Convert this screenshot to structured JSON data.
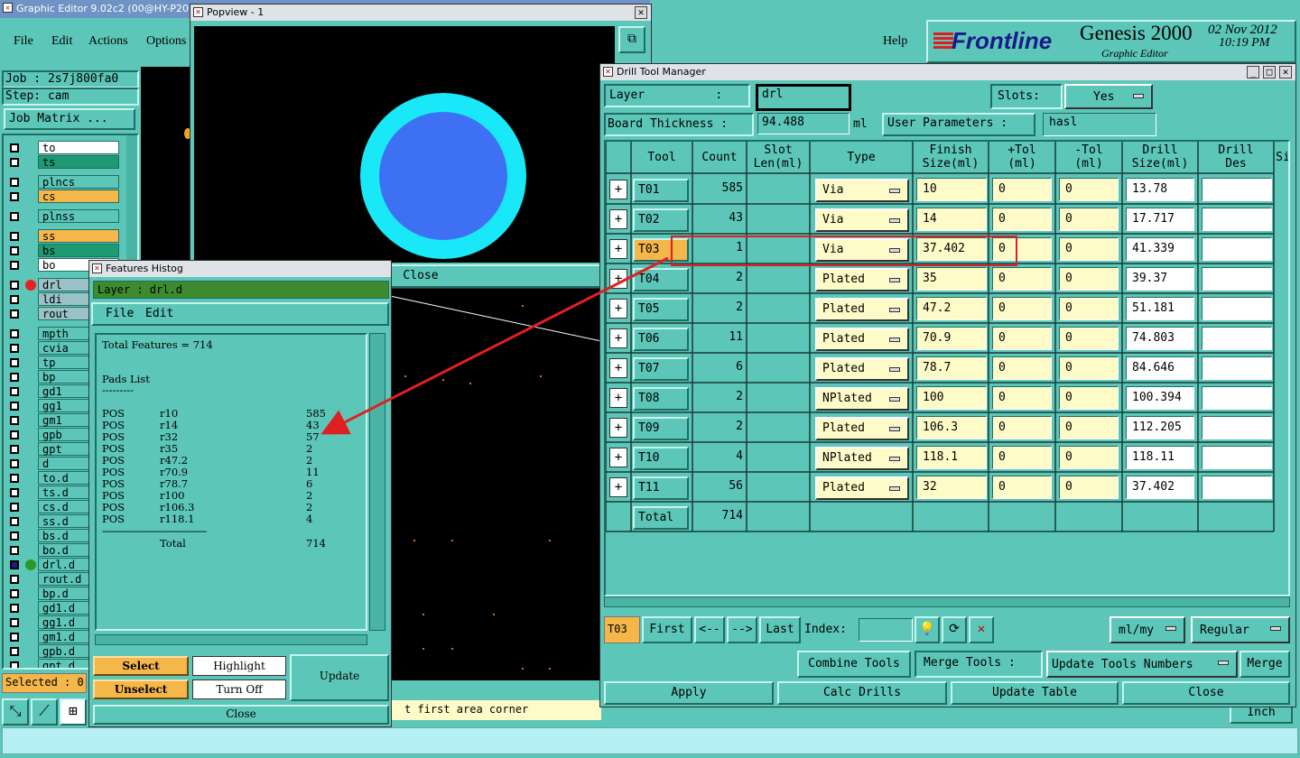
{
  "main_window": {
    "title": "Graphic Editor 9.02c2 (00@HY-P20",
    "menu": [
      "File",
      "Edit",
      "Actions",
      "Options"
    ],
    "help": "Help",
    "brand": "Frontline",
    "product": "Genesis 2000",
    "product_sub": "Graphic Editor",
    "date": "02 Nov 2012",
    "time": "10:19 PM",
    "job": "Job : 2s7j800fa0",
    "step": "Step: cam",
    "job_matrix": "Job Matrix ...",
    "selected": "Selected : 0",
    "status_msg": "t first area corner",
    "units": "Inch"
  },
  "layers": [
    {
      "name": "to",
      "color": "#ffffff"
    },
    {
      "name": "ts",
      "color": "#1e9a72"
    },
    {
      "name": "plncs",
      "color": "#5cc6b8"
    },
    {
      "name": "cs",
      "color": "#f5b64a"
    },
    {
      "name": "plnss",
      "color": "#5cc6b8"
    },
    {
      "name": "ss",
      "color": "#f5b64a"
    },
    {
      "name": "bs",
      "color": "#1e9a72"
    },
    {
      "name": "bo",
      "color": "#ffffff"
    },
    {
      "name": "drl",
      "color": "#9bc2c7"
    },
    {
      "name": "ldi",
      "color": "#9bc2c7"
    },
    {
      "name": "rout",
      "color": "#9bc2c7"
    },
    {
      "name": "mpth",
      "color": "#5cc6b8"
    },
    {
      "name": "cvia",
      "color": "#5cc6b8"
    },
    {
      "name": "tp",
      "color": "#5cc6b8"
    },
    {
      "name": "bp",
      "color": "#5cc6b8"
    },
    {
      "name": "gd1",
      "color": "#5cc6b8"
    },
    {
      "name": "gg1",
      "color": "#5cc6b8"
    },
    {
      "name": "gm1",
      "color": "#5cc6b8"
    },
    {
      "name": "gpb",
      "color": "#5cc6b8"
    },
    {
      "name": "gpt",
      "color": "#5cc6b8"
    },
    {
      "name": "d",
      "color": "#5cc6b8"
    },
    {
      "name": "to.d",
      "color": "#5cc6b8"
    },
    {
      "name": "ts.d",
      "color": "#5cc6b8"
    },
    {
      "name": "cs.d",
      "color": "#5cc6b8"
    },
    {
      "name": "ss.d",
      "color": "#5cc6b8"
    },
    {
      "name": "bs.d",
      "color": "#5cc6b8"
    },
    {
      "name": "bo.d",
      "color": "#5cc6b8"
    },
    {
      "name": "drl.d",
      "color": "#5cc6b8"
    },
    {
      "name": "rout.d",
      "color": "#5cc6b8"
    },
    {
      "name": "bp.d",
      "color": "#5cc6b8"
    },
    {
      "name": "gd1.d",
      "color": "#5cc6b8"
    },
    {
      "name": "gg1.d",
      "color": "#5cc6b8"
    },
    {
      "name": "gm1.d",
      "color": "#5cc6b8"
    },
    {
      "name": "gpb.d",
      "color": "#5cc6b8"
    },
    {
      "name": "gpt.d",
      "color": "#5cc6b8"
    }
  ],
  "popview": {
    "title": "Popview - 1",
    "close": "Close"
  },
  "histogram": {
    "title": "Features Histog",
    "layer_label": "Layer :  drl.d",
    "menu": [
      "File",
      "Edit"
    ],
    "total_features": "Total Features = 714",
    "pads_list": "Pads List",
    "rule_short": "---------",
    "rows": [
      {
        "type": "POS",
        "sym": "r10",
        "count": "585"
      },
      {
        "type": "POS",
        "sym": "r14",
        "count": "43"
      },
      {
        "type": "POS",
        "sym": "r32",
        "count": "57"
      },
      {
        "type": "POS",
        "sym": "r35",
        "count": "2"
      },
      {
        "type": "POS",
        "sym": "r47.2",
        "count": "2"
      },
      {
        "type": "POS",
        "sym": "r70.9",
        "count": "11"
      },
      {
        "type": "POS",
        "sym": "r78.7",
        "count": "6"
      },
      {
        "type": "POS",
        "sym": "r100",
        "count": "2"
      },
      {
        "type": "POS",
        "sym": "r106.3",
        "count": "2"
      },
      {
        "type": "POS",
        "sym": "r118.1",
        "count": "4"
      }
    ],
    "rule_long": "----------------------------------------",
    "total_label": "Total",
    "total_value": "714",
    "select": "Select",
    "unselect": "Unselect",
    "highlight": "Highlight",
    "turn_off": "Turn Off",
    "update": "Update",
    "close": "Close"
  },
  "dtm": {
    "title": "Drill Tool Manager",
    "layer_label": "Layer          :",
    "layer_value": "drl",
    "slots_label": "Slots:",
    "slots_value": "Yes",
    "thick_label": "Board Thickness :",
    "thick_value": "94.488",
    "thick_unit": "ml",
    "user_params": "User Parameters :",
    "user_params_value": "hasl",
    "headers": [
      [
        "Tool",
        ""
      ],
      [
        "Count",
        ""
      ],
      [
        "Slot",
        "Len(ml)"
      ],
      [
        "Type",
        ""
      ],
      [
        "Finish",
        "Size(ml)"
      ],
      [
        "+Tol",
        "(ml)"
      ],
      [
        "-Tol",
        "(ml)"
      ],
      [
        "Drill",
        "Size(ml)"
      ],
      [
        "Drill",
        "Des"
      ],
      [
        "Si",
        ""
      ]
    ],
    "rows": [
      {
        "tool": "T01",
        "count": "585",
        "type": "Via",
        "finish": "10",
        "ptol": "0",
        "mtol": "0",
        "drill": "13.78"
      },
      {
        "tool": "T02",
        "count": "43",
        "type": "Via",
        "finish": "14",
        "ptol": "0",
        "mtol": "0",
        "drill": "17.717"
      },
      {
        "tool": "T03",
        "count": "1",
        "type": "Via",
        "finish": "37.402",
        "ptol": "0",
        "mtol": "0",
        "drill": "41.339"
      },
      {
        "tool": "T04",
        "count": "2",
        "type": "Plated",
        "finish": "35",
        "ptol": "0",
        "mtol": "0",
        "drill": "39.37"
      },
      {
        "tool": "T05",
        "count": "2",
        "type": "Plated",
        "finish": "47.2",
        "ptol": "0",
        "mtol": "0",
        "drill": "51.181"
      },
      {
        "tool": "T06",
        "count": "11",
        "type": "Plated",
        "finish": "70.9",
        "ptol": "0",
        "mtol": "0",
        "drill": "74.803"
      },
      {
        "tool": "T07",
        "count": "6",
        "type": "Plated",
        "finish": "78.7",
        "ptol": "0",
        "mtol": "0",
        "drill": "84.646"
      },
      {
        "tool": "T08",
        "count": "2",
        "type": "NPlated",
        "finish": "100",
        "ptol": "0",
        "mtol": "0",
        "drill": "100.394"
      },
      {
        "tool": "T09",
        "count": "2",
        "type": "Plated",
        "finish": "106.3",
        "ptol": "0",
        "mtol": "0",
        "drill": "112.205"
      },
      {
        "tool": "T10",
        "count": "4",
        "type": "NPlated",
        "finish": "118.1",
        "ptol": "0",
        "mtol": "0",
        "drill": "118.11"
      },
      {
        "tool": "T11",
        "count": "56",
        "type": "Plated",
        "finish": "32",
        "ptol": "0",
        "mtol": "0",
        "drill": "37.402"
      }
    ],
    "total_label": "Total",
    "total_value": "714",
    "current_tool": "T03",
    "first": "First",
    "prev": "<--",
    "next": "-->",
    "last": "Last",
    "index_label": "Index:",
    "units_menu": "ml/my",
    "mode_menu": "Regular",
    "combine": "Combine Tools",
    "merge_label": "Merge Tools :",
    "update_numbers": "Update Tools Numbers",
    "merge": "Merge",
    "apply": "Apply",
    "calc": "Calc Drills",
    "update_table": "Update Table",
    "close": "Close"
  },
  "colors": {
    "accent_teal": "#5cc6b8",
    "highlight": "#f5b64a",
    "field": "#fffbc8",
    "annotation": "#e02020"
  }
}
